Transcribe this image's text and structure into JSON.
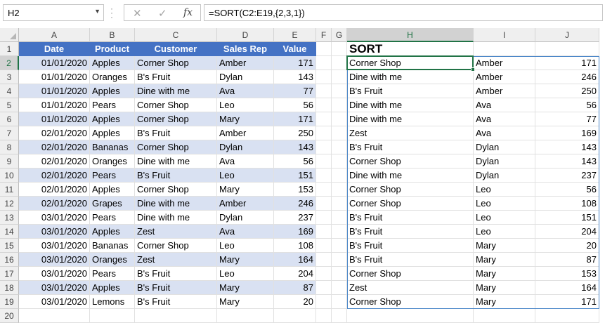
{
  "name_box": "H2",
  "formula": "=SORT(C2:E19,{2,3,1})",
  "formula_buttons": {
    "cancel": "✕",
    "enter": "✓",
    "insert_function": "fx"
  },
  "columns": [
    "A",
    "B",
    "C",
    "D",
    "E",
    "F",
    "G",
    "H",
    "I",
    "J"
  ],
  "selected_column": "H",
  "rows": [
    "1",
    "2",
    "3",
    "4",
    "5",
    "6",
    "7",
    "8",
    "9",
    "10",
    "11",
    "12",
    "13",
    "14",
    "15",
    "16",
    "17",
    "18",
    "19",
    "20"
  ],
  "selected_row": "2",
  "table": {
    "headers": [
      "Date",
      "Product",
      "Customer",
      "Sales Rep",
      "Value"
    ],
    "rows": [
      [
        "01/01/2020",
        "Apples",
        "Corner Shop",
        "Amber",
        "171"
      ],
      [
        "01/01/2020",
        "Oranges",
        "B's Fruit",
        "Dylan",
        "143"
      ],
      [
        "01/01/2020",
        "Apples",
        "Dine with me",
        "Ava",
        "77"
      ],
      [
        "01/01/2020",
        "Pears",
        "Corner Shop",
        "Leo",
        "56"
      ],
      [
        "01/01/2020",
        "Apples",
        "Corner Shop",
        "Mary",
        "171"
      ],
      [
        "02/01/2020",
        "Apples",
        "B's Fruit",
        "Amber",
        "250"
      ],
      [
        "02/01/2020",
        "Bananas",
        "Corner Shop",
        "Dylan",
        "143"
      ],
      [
        "02/01/2020",
        "Oranges",
        "Dine with me",
        "Ava",
        "56"
      ],
      [
        "02/01/2020",
        "Pears",
        "B's Fruit",
        "Leo",
        "151"
      ],
      [
        "02/01/2020",
        "Apples",
        "Corner Shop",
        "Mary",
        "153"
      ],
      [
        "02/01/2020",
        "Grapes",
        "Dine with me",
        "Amber",
        "246"
      ],
      [
        "03/01/2020",
        "Pears",
        "Dine with me",
        "Dylan",
        "237"
      ],
      [
        "03/01/2020",
        "Apples",
        "Zest",
        "Ava",
        "169"
      ],
      [
        "03/01/2020",
        "Bananas",
        "Corner Shop",
        "Leo",
        "108"
      ],
      [
        "03/01/2020",
        "Oranges",
        "Zest",
        "Mary",
        "164"
      ],
      [
        "03/01/2020",
        "Pears",
        "B's Fruit",
        "Leo",
        "204"
      ],
      [
        "03/01/2020",
        "Apples",
        "B's Fruit",
        "Mary",
        "87"
      ],
      [
        "03/01/2020",
        "Lemons",
        "B's Fruit",
        "Mary",
        "20"
      ]
    ]
  },
  "sort_title": "SORT",
  "sorted": [
    [
      "Corner Shop",
      "Amber",
      "171"
    ],
    [
      "Dine with me",
      "Amber",
      "246"
    ],
    [
      "B's Fruit",
      "Amber",
      "250"
    ],
    [
      "Dine with me",
      "Ava",
      "56"
    ],
    [
      "Dine with me",
      "Ava",
      "77"
    ],
    [
      "Zest",
      "Ava",
      "169"
    ],
    [
      "B's Fruit",
      "Dylan",
      "143"
    ],
    [
      "Corner Shop",
      "Dylan",
      "143"
    ],
    [
      "Dine with me",
      "Dylan",
      "237"
    ],
    [
      "Corner Shop",
      "Leo",
      "56"
    ],
    [
      "Corner Shop",
      "Leo",
      "108"
    ],
    [
      "B's Fruit",
      "Leo",
      "151"
    ],
    [
      "B's Fruit",
      "Leo",
      "204"
    ],
    [
      "B's Fruit",
      "Mary",
      "20"
    ],
    [
      "B's Fruit",
      "Mary",
      "87"
    ],
    [
      "Corner Shop",
      "Mary",
      "153"
    ],
    [
      "Zest",
      "Mary",
      "164"
    ],
    [
      "Corner Shop",
      "Mary",
      "171"
    ]
  ],
  "colors": {
    "header_fill": "#4472c4",
    "band_fill": "#d9e1f2",
    "selection": "#217346",
    "spill_border": "#4a86c8"
  }
}
